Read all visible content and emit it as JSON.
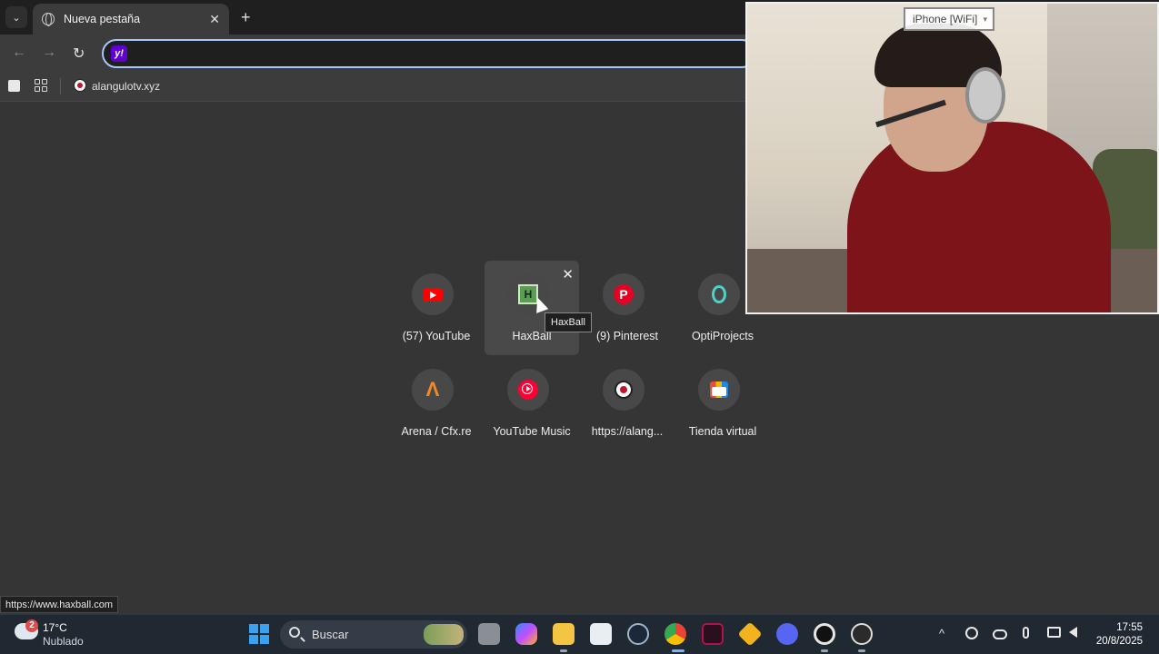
{
  "browser": {
    "tab": {
      "title": "Nueva pestaña",
      "close_glyph": "✕"
    },
    "tab_search_glyph": "⌄",
    "new_tab_glyph": "+",
    "nav": {
      "back": "←",
      "forward": "→",
      "reload": "↻"
    },
    "omnibox": {
      "value": "",
      "engine_icon": "yahoo-icon",
      "engine_glyph": "y!"
    },
    "bookmarks": {
      "items": [
        {
          "label": "alangulotv.xyz",
          "icon": "soccer-ball-icon"
        }
      ]
    }
  },
  "shortcuts": [
    {
      "label": "(57) YouTube",
      "icon": "youtube-icon"
    },
    {
      "label": "HaxBall",
      "icon": "haxball-icon",
      "glyph": "H"
    },
    {
      "label": "(9) Pinterest",
      "icon": "pinterest-icon",
      "glyph": "P"
    },
    {
      "label": "OptiProjects",
      "icon": "optiprojects-icon"
    },
    {
      "label": "Arena / Cfx.re",
      "icon": "arena-icon",
      "glyph": "Λ"
    },
    {
      "label": "YouTube Music",
      "icon": "youtube-music-icon"
    },
    {
      "label": "https://alang...",
      "icon": "soccer-ball-icon"
    },
    {
      "label": "Tienda virtual",
      "icon": "store-icon"
    }
  ],
  "hover": {
    "tooltip": "HaxBall",
    "remove_glyph": "✕",
    "status_url": "https://www.haxball.com"
  },
  "webcam": {
    "source_label": "iPhone [WiFi]",
    "dropdown_glyph": "▾"
  },
  "taskbar": {
    "weather": {
      "temp": "17°C",
      "condition": "Nublado",
      "badge": "2"
    },
    "search_placeholder": "Buscar",
    "apps": [
      "file-explorer-thumb-icon",
      "copilot-icon",
      "folder-icon",
      "store-icon",
      "steam-icon",
      "chrome-icon",
      "video-editor-icon",
      "app-icon",
      "discord-icon",
      "webcam-app-icon",
      "obs-icon"
    ],
    "tray": {
      "chevron": "^"
    },
    "clock": {
      "time": "17:55",
      "date": "20/8/2025"
    }
  },
  "colors": {
    "accent": "#a8c7fa",
    "youtube": "#ff0000",
    "pinterest": "#e60023",
    "yahoo": "#6001d2"
  }
}
